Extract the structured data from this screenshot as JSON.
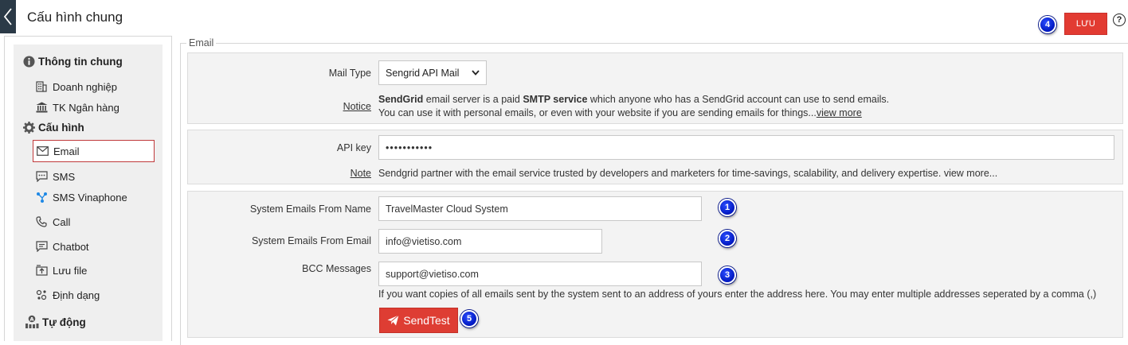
{
  "header": {
    "title": "Cấu hình chung",
    "save_label": "LƯU",
    "help_label": "?"
  },
  "badges": [
    "1",
    "2",
    "3",
    "4",
    "5"
  ],
  "sidebar": {
    "groups": [
      {
        "label": "Thông tin chung",
        "icon": "info-icon"
      },
      {
        "label": "Cấu hình",
        "icon": "gear-icon"
      },
      {
        "label": "Tự động",
        "icon": "automation-icon"
      }
    ],
    "items": [
      {
        "label": "Doanh nghiệp",
        "icon": "building-icon"
      },
      {
        "label": "TK Ngân hàng",
        "icon": "bank-icon"
      },
      {
        "label": "Email",
        "icon": "envelope-icon",
        "active": true
      },
      {
        "label": "SMS",
        "icon": "chat-icon"
      },
      {
        "label": "SMS Vinaphone",
        "icon": "share-icon"
      },
      {
        "label": "Call",
        "icon": "phone-icon"
      },
      {
        "label": "Chatbot",
        "icon": "chatbot-icon"
      },
      {
        "label": "Lưu file",
        "icon": "upload-icon"
      },
      {
        "label": "Định dạng",
        "icon": "format-icon"
      }
    ]
  },
  "email": {
    "legend": "Email",
    "mail_type": {
      "label": "Mail Type",
      "value": "Sengrid API Mail",
      "notice_label": "Notice",
      "notice_bold1": "SendGrid",
      "notice_text1": " email server is a paid ",
      "notice_bold2": "SMTP service",
      "notice_text2": " which anyone who has a SendGrid account can use to send emails.",
      "notice_line2": "You can use it with personal emails, or even with your website if you are sending emails for things...",
      "view_more": "view more"
    },
    "api_key": {
      "label": "API key",
      "value": "•••••••••••",
      "note_label": "Note",
      "note_text": "Sendgrid partner with the email service trusted by developers and marketers for time-savings, scalability, and delivery expertise. view more..."
    },
    "from_name": {
      "label": "System Emails From Name",
      "value": "TravelMaster Cloud System"
    },
    "from_email": {
      "label": "System Emails From Email",
      "value": "info@vietiso.com"
    },
    "bcc": {
      "label": "BCC Messages",
      "value": "support@vietiso.com",
      "hint": "If you want copies of all emails sent by the system sent to an address of yours enter the address here. You may enter multiple addresses seperated by a comma (,)"
    },
    "send_test_label": "SendTest"
  },
  "colors": {
    "accent": "#e23b32",
    "badge": "#0018c0",
    "sidebar_bg": "#efefef",
    "dark": "#2b3a47"
  }
}
